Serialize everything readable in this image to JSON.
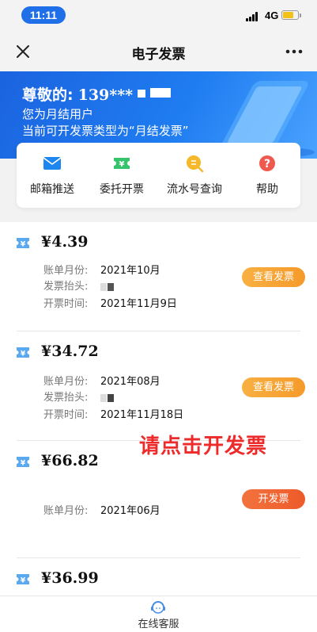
{
  "status_bar": {
    "time": "11:11",
    "network": "4G"
  },
  "nav": {
    "title": "电子发票"
  },
  "banner": {
    "greeting": "尊敬的:",
    "phone_masked": "139***",
    "account_type": "您为月结用户",
    "invoice_type_note": "当前可开发票类型为“月结发票”"
  },
  "quick_actions": [
    {
      "label": "邮箱推送",
      "icon": "mail-icon"
    },
    {
      "label": "委托开票",
      "icon": "invoice-ticket-icon"
    },
    {
      "label": "流水号查询",
      "icon": "serial-query-icon"
    },
    {
      "label": "帮助",
      "icon": "help-icon"
    }
  ],
  "invoices": [
    {
      "amount": "¥4.39",
      "bill_month_label": "账单月份:",
      "bill_month": "2021年10月",
      "title_label": "发票抬头:",
      "issue_time_label": "开票时间:",
      "issue_time": "2021年11月9日",
      "action": "查看发票"
    },
    {
      "amount": "¥34.72",
      "bill_month_label": "账单月份:",
      "bill_month": "2021年08月",
      "title_label": "发票抬头:",
      "issue_time_label": "开票时间:",
      "issue_time": "2021年11月18日",
      "action": "查看发票"
    },
    {
      "amount": "¥66.82",
      "bill_month_label": "账单月份:",
      "bill_month": "2021年06月",
      "action": "开发票"
    },
    {
      "amount": "¥36.99"
    }
  ],
  "annotation": "请点击开发票",
  "bottom": {
    "customer_service": "在线客服"
  },
  "colors": {
    "primary_blue": "#1f6fe8",
    "view_button": "#f5a233",
    "issue_button": "#f0663a",
    "annotation_red": "#ee2b2b"
  }
}
